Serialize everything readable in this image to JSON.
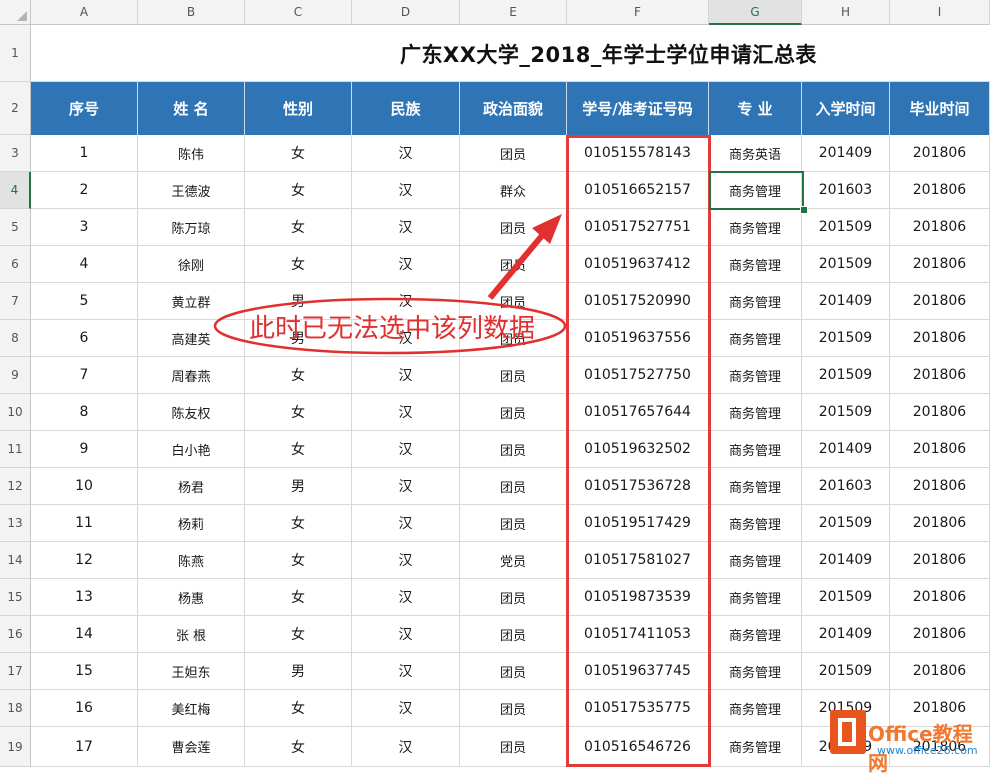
{
  "columns": [
    "A",
    "B",
    "C",
    "D",
    "E",
    "F",
    "G",
    "H",
    "I"
  ],
  "active_column": "G",
  "active_row": "4",
  "title": "广东XX大学_2018_年学士学位申请汇总表",
  "header_row": [
    "序号",
    "姓 名",
    "性别",
    "民族",
    "政治面貌",
    "学号/准考证号码",
    "专 业",
    "入学时间",
    "毕业时间"
  ],
  "row_numbers": [
    "1",
    "2",
    "3",
    "4",
    "5",
    "6",
    "7",
    "8",
    "9",
    "10",
    "11",
    "12",
    "13",
    "14",
    "15",
    "16",
    "17",
    "18",
    "19"
  ],
  "rows": [
    [
      "1",
      "陈伟",
      "女",
      "汉",
      "团员",
      "010515578143",
      "商务英语",
      "201409",
      "201806"
    ],
    [
      "2",
      "王德波",
      "女",
      "汉",
      "群众",
      "010516652157",
      "商务管理",
      "201603",
      "201806"
    ],
    [
      "3",
      "陈万琼",
      "女",
      "汉",
      "团员",
      "010517527751",
      "商务管理",
      "201509",
      "201806"
    ],
    [
      "4",
      "徐刚",
      "女",
      "汉",
      "团员",
      "010519637412",
      "商务管理",
      "201509",
      "201806"
    ],
    [
      "5",
      "黄立群",
      "男",
      "汉",
      "团员",
      "010517520990",
      "商务管理",
      "201409",
      "201806"
    ],
    [
      "6",
      "高建英",
      "男",
      "汉",
      "团员",
      "010519637556",
      "商务管理",
      "201509",
      "201806"
    ],
    [
      "7",
      "周春燕",
      "女",
      "汉",
      "团员",
      "010517527750",
      "商务管理",
      "201509",
      "201806"
    ],
    [
      "8",
      "陈友权",
      "女",
      "汉",
      "团员",
      "010517657644",
      "商务管理",
      "201509",
      "201806"
    ],
    [
      "9",
      "白小艳",
      "女",
      "汉",
      "团员",
      "010519632502",
      "商务管理",
      "201409",
      "201806"
    ],
    [
      "10",
      "杨君",
      "男",
      "汉",
      "团员",
      "010517536728",
      "商务管理",
      "201603",
      "201806"
    ],
    [
      "11",
      "杨莉",
      "女",
      "汉",
      "团员",
      "010519517429",
      "商务管理",
      "201509",
      "201806"
    ],
    [
      "12",
      "陈燕",
      "女",
      "汉",
      "党员",
      "010517581027",
      "商务管理",
      "201409",
      "201806"
    ],
    [
      "13",
      "杨惠",
      "女",
      "汉",
      "团员",
      "010519873539",
      "商务管理",
      "201509",
      "201806"
    ],
    [
      "14",
      "张 根",
      "女",
      "汉",
      "团员",
      "010517411053",
      "商务管理",
      "201409",
      "201806"
    ],
    [
      "15",
      "王妲东",
      "男",
      "汉",
      "团员",
      "010519637745",
      "商务管理",
      "201509",
      "201806"
    ],
    [
      "16",
      "美红梅",
      "女",
      "汉",
      "团员",
      "010517535775",
      "商务管理",
      "201509",
      "201806"
    ],
    [
      "17",
      "曹会莲",
      "女",
      "汉",
      "团员",
      "010516546726",
      "商务管理",
      "201409",
      "201806"
    ]
  ],
  "annotation": "此时已无法选中该列数据",
  "watermark": {
    "brand": "Office教程网",
    "url": "www.office26.com"
  },
  "colors": {
    "header_fill": "#2f75b5",
    "annotation": "#e03030",
    "selection": "#217346"
  }
}
